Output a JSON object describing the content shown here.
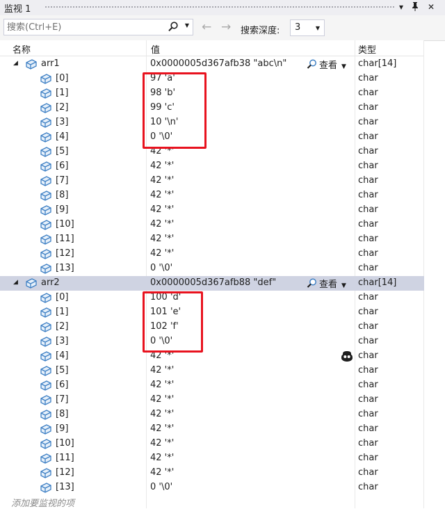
{
  "window": {
    "title": "监视 1"
  },
  "toolbar": {
    "search_placeholder": "搜索(Ctrl+E)",
    "depth_label": "搜索深度:",
    "depth_value": "3"
  },
  "columns": {
    "name": "名称",
    "value": "值",
    "type": "类型"
  },
  "view_label": "查看",
  "add_item": "添加要监视的项",
  "rows": [
    {
      "kind": "parent",
      "name": "arr1",
      "value": "0x0000005d367afb38 \"abc\\n\"",
      "type": "char[14]"
    },
    {
      "kind": "child",
      "name": "[0]",
      "value": "97 'a'",
      "type": "char"
    },
    {
      "kind": "child",
      "name": "[1]",
      "value": "98 'b'",
      "type": "char"
    },
    {
      "kind": "child",
      "name": "[2]",
      "value": "99 'c'",
      "type": "char"
    },
    {
      "kind": "child",
      "name": "[3]",
      "value": "10 '\\n'",
      "type": "char"
    },
    {
      "kind": "child",
      "name": "[4]",
      "value": "0 '\\0'",
      "type": "char"
    },
    {
      "kind": "child",
      "name": "[5]",
      "value": "42 '*'",
      "type": "char"
    },
    {
      "kind": "child",
      "name": "[6]",
      "value": "42 '*'",
      "type": "char"
    },
    {
      "kind": "child",
      "name": "[7]",
      "value": "42 '*'",
      "type": "char"
    },
    {
      "kind": "child",
      "name": "[8]",
      "value": "42 '*'",
      "type": "char"
    },
    {
      "kind": "child",
      "name": "[9]",
      "value": "42 '*'",
      "type": "char"
    },
    {
      "kind": "child",
      "name": "[10]",
      "value": "42 '*'",
      "type": "char"
    },
    {
      "kind": "child",
      "name": "[11]",
      "value": "42 '*'",
      "type": "char"
    },
    {
      "kind": "child",
      "name": "[12]",
      "value": "42 '*'",
      "type": "char"
    },
    {
      "kind": "child",
      "name": "[13]",
      "value": "0 '\\0'",
      "type": "char"
    },
    {
      "kind": "parent",
      "name": "arr2",
      "value": "0x0000005d367afb88 \"def\"",
      "type": "char[14]",
      "selected": true
    },
    {
      "kind": "child",
      "name": "[0]",
      "value": "100 'd'",
      "type": "char"
    },
    {
      "kind": "child",
      "name": "[1]",
      "value": "101 'e'",
      "type": "char"
    },
    {
      "kind": "child",
      "name": "[2]",
      "value": "102 'f'",
      "type": "char"
    },
    {
      "kind": "child",
      "name": "[3]",
      "value": "0 '\\0'",
      "type": "char"
    },
    {
      "kind": "child",
      "name": "[4]",
      "value": "42 '*'",
      "type": "char",
      "copilot": true
    },
    {
      "kind": "child",
      "name": "[5]",
      "value": "42 '*'",
      "type": "char"
    },
    {
      "kind": "child",
      "name": "[6]",
      "value": "42 '*'",
      "type": "char"
    },
    {
      "kind": "child",
      "name": "[7]",
      "value": "42 '*'",
      "type": "char"
    },
    {
      "kind": "child",
      "name": "[8]",
      "value": "42 '*'",
      "type": "char"
    },
    {
      "kind": "child",
      "name": "[9]",
      "value": "42 '*'",
      "type": "char"
    },
    {
      "kind": "child",
      "name": "[10]",
      "value": "42 '*'",
      "type": "char"
    },
    {
      "kind": "child",
      "name": "[11]",
      "value": "42 '*'",
      "type": "char"
    },
    {
      "kind": "child",
      "name": "[12]",
      "value": "42 '*'",
      "type": "char"
    },
    {
      "kind": "child",
      "name": "[13]",
      "value": "0 '\\0'",
      "type": "char"
    }
  ],
  "colors": {
    "selected_row": "#cfd3e2",
    "highlight_box": "#e8121e",
    "icon_blue": "#3d7fc4"
  }
}
